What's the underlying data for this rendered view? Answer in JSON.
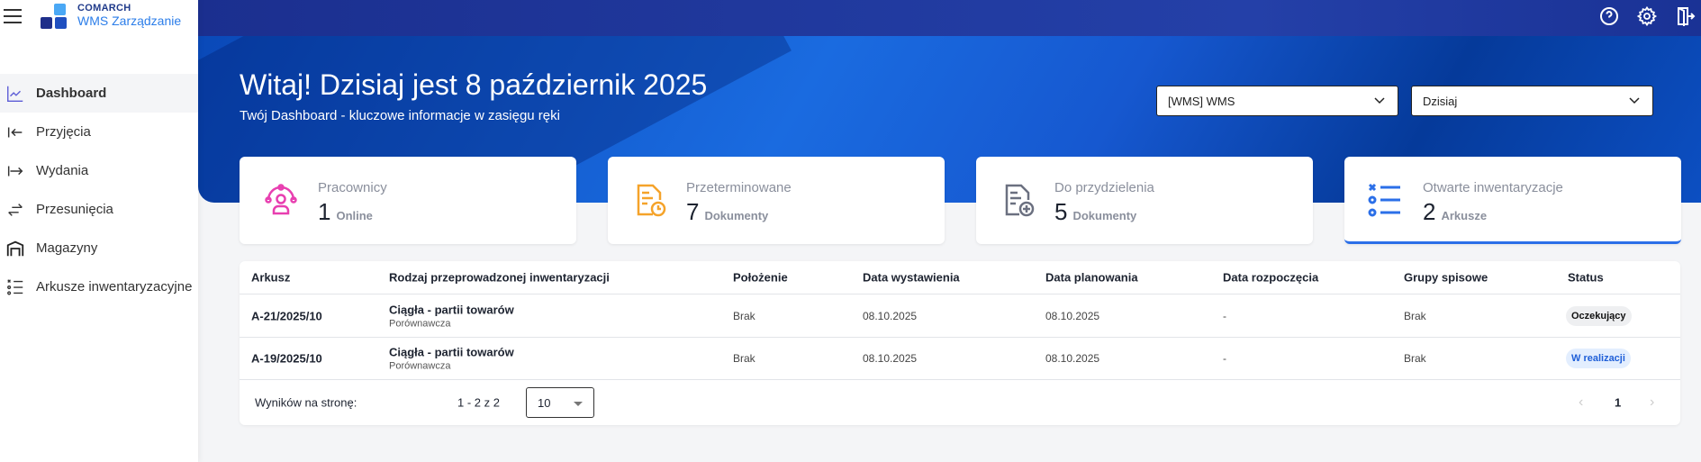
{
  "app": {
    "brand": "COMARCH",
    "product": "WMS Zarządzanie"
  },
  "sidebar": {
    "items": [
      {
        "label": "Dashboard",
        "icon": "chart-line-icon",
        "active": true
      },
      {
        "label": "Przyjęcia",
        "icon": "arrow-left-bar-icon"
      },
      {
        "label": "Wydania",
        "icon": "arrow-right-bar-icon"
      },
      {
        "label": "Przesunięcia",
        "icon": "swap-icon"
      },
      {
        "label": "Magazyny",
        "icon": "warehouse-icon"
      },
      {
        "label": "Arkusze inwentaryzacyjne",
        "icon": "checklist-icon"
      }
    ]
  },
  "header": {
    "title": "Witaj! Dzisiaj jest 8 październik 2025",
    "subtitle": "Twój Dashboard - kluczowe informacje w zasięgu ręki",
    "warehouse_select": "[WMS] WMS",
    "period_select": "Dzisiaj"
  },
  "cards": [
    {
      "label": "Pracownicy",
      "value": "1",
      "unit": "Online",
      "color": "#e83fb0"
    },
    {
      "label": "Przeterminowane",
      "value": "7",
      "unit": "Dokumenty",
      "color": "#f5a32a"
    },
    {
      "label": "Do przydzielenia",
      "value": "5",
      "unit": "Dokumenty",
      "color": "#6b7080"
    },
    {
      "label": "Otwarte inwentaryzacje",
      "value": "2",
      "unit": "Arkusze",
      "color": "#2b6fe8"
    }
  ],
  "table": {
    "columns": [
      "Arkusz",
      "Rodzaj przeprowadzonej inwentaryzacji",
      "Położenie",
      "Data wystawienia",
      "Data planowania",
      "Data rozpoczęcia",
      "Grupy spisowe",
      "Status"
    ],
    "rows": [
      {
        "arkusz": "A-21/2025/10",
        "rodzaj": "Ciągła - partii towarów",
        "rodzaj_sub": "Porównawcza",
        "polozenie": "Brak",
        "data_wyst": "08.10.2025",
        "data_plan": "08.10.2025",
        "data_rozp": "-",
        "grupy": "Brak",
        "status": "Oczekujący"
      },
      {
        "arkusz": "A-19/2025/10",
        "rodzaj": "Ciągła - partii towarów",
        "rodzaj_sub": "Porównawcza",
        "polozenie": "Brak",
        "data_wyst": "08.10.2025",
        "data_plan": "08.10.2025",
        "data_rozp": "-",
        "grupy": "Brak",
        "status": "W realizacji"
      }
    ],
    "per_page_label": "Wyników na stronę:",
    "per_page": "10",
    "range": "1 - 2 z 2",
    "page": "1"
  }
}
